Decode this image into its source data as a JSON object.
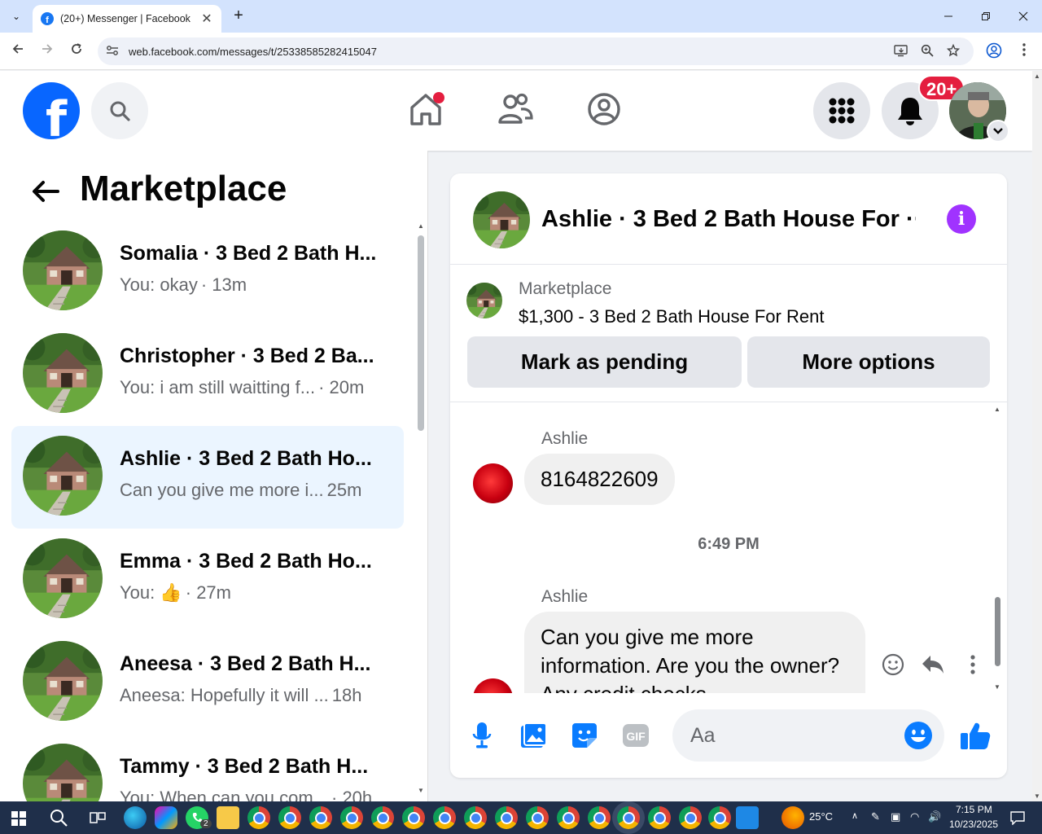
{
  "browser": {
    "tab_title": "(20+) Messenger | Facebook",
    "url": "web.facebook.com/messages/t/25338585282415047",
    "new_tab": "+",
    "close_tab": "✕"
  },
  "fb_header": {
    "notification_badge": "20+"
  },
  "left_panel": {
    "title": "Marketplace",
    "conversations": [
      {
        "name": "Somalia · 3 Bed 2 Bath H...",
        "preview": "You: okay",
        "time": "· 13m",
        "active": false
      },
      {
        "name": "Christopher · 3 Bed 2 Ba...",
        "preview": "You: i am still waitting f...",
        "time": "· 20m",
        "active": false
      },
      {
        "name": "Ashlie · 3 Bed 2 Bath Ho...",
        "preview": "Can you give me more i...",
        "time": "25m",
        "active": true
      },
      {
        "name": "Emma · 3 Bed 2 Bath Ho...",
        "preview": "You: 👍",
        "time": "· 27m",
        "active": false
      },
      {
        "name": "Aneesa · 3 Bed 2 Bath H...",
        "preview": "Aneesa: Hopefully it will ...",
        "time": "18h",
        "active": false
      },
      {
        "name": "Tammy · 3 Bed 2 Bath H...",
        "preview": "You: When can you com...",
        "time": "· 20h",
        "active": false
      }
    ]
  },
  "chat": {
    "title": "Ashlie · 3 Bed 2 Bath House For ···",
    "listing_label": "Marketplace",
    "listing_title": "$1,300 - 3 Bed 2 Bath House For Rent",
    "mark_pending": "Mark as pending",
    "more_options": "More options",
    "messages": [
      {
        "sender": "Ashlie",
        "text": "8164822609"
      },
      {
        "sender": "Ashlie",
        "text": "Can you give  me more information. Are you the owner? Any credit checks"
      }
    ],
    "time_separator": "6:49 PM",
    "composer_placeholder": "Aa"
  },
  "taskbar": {
    "weather": "25°C",
    "time": "7:15 PM",
    "date": "10/23/2025",
    "whatsapp_count": "2"
  },
  "colors": {
    "facebook_blue": "#0866ff",
    "messenger_blue": "#0a7cff",
    "info_purple": "#a033ff",
    "badge_red": "#e41e3f",
    "active_row": "#ebf5ff"
  }
}
